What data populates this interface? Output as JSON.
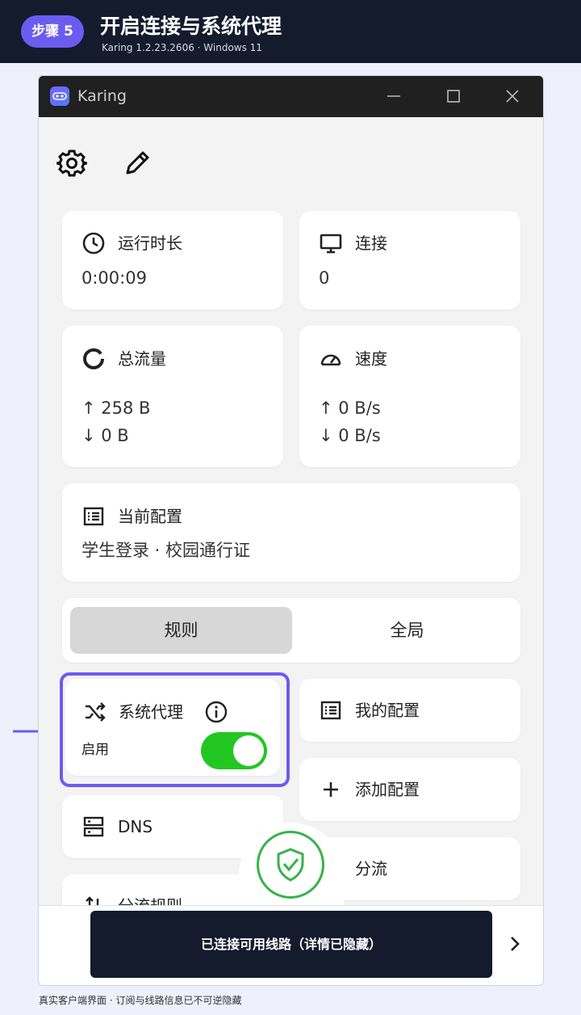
{
  "banner": {
    "step": "步骤 5",
    "title": "开启连接与系统代理",
    "subtitle": "Karing 1.2.23.2606 · Windows 11"
  },
  "window": {
    "title": "Karing"
  },
  "cards": {
    "uptime": {
      "title": "运行时长",
      "value": "0:00:09"
    },
    "connections": {
      "title": "连接",
      "value": "0"
    },
    "traffic": {
      "title": "总流量",
      "up": "↑ 258 B",
      "down": "↓ 0 B"
    },
    "speed": {
      "title": "速度",
      "up": "↑ 0 B/s",
      "down": "↓ 0 B/s"
    },
    "current_config": {
      "title": "当前配置",
      "value": "学生登录 · 校园通行证"
    }
  },
  "mode": {
    "rule": "规则",
    "global": "全局",
    "selected": "规则"
  },
  "system_proxy": {
    "title": "系统代理",
    "label": "启用",
    "enabled": true
  },
  "menu": {
    "my_config": "我的配置",
    "add_config": "添加配置",
    "dns": "DNS",
    "split": "分流",
    "split_rules": "分流规则"
  },
  "status": {
    "text": "已连接可用线路（详情已隐藏）"
  },
  "caption": "真实客户端界面 · 订阅与线路信息已不可逆隐藏",
  "colors": {
    "accent": "#6b5cf0",
    "toggle_on": "#22c722",
    "shield": "#35b34a",
    "dark_bg": "#141b2d"
  }
}
